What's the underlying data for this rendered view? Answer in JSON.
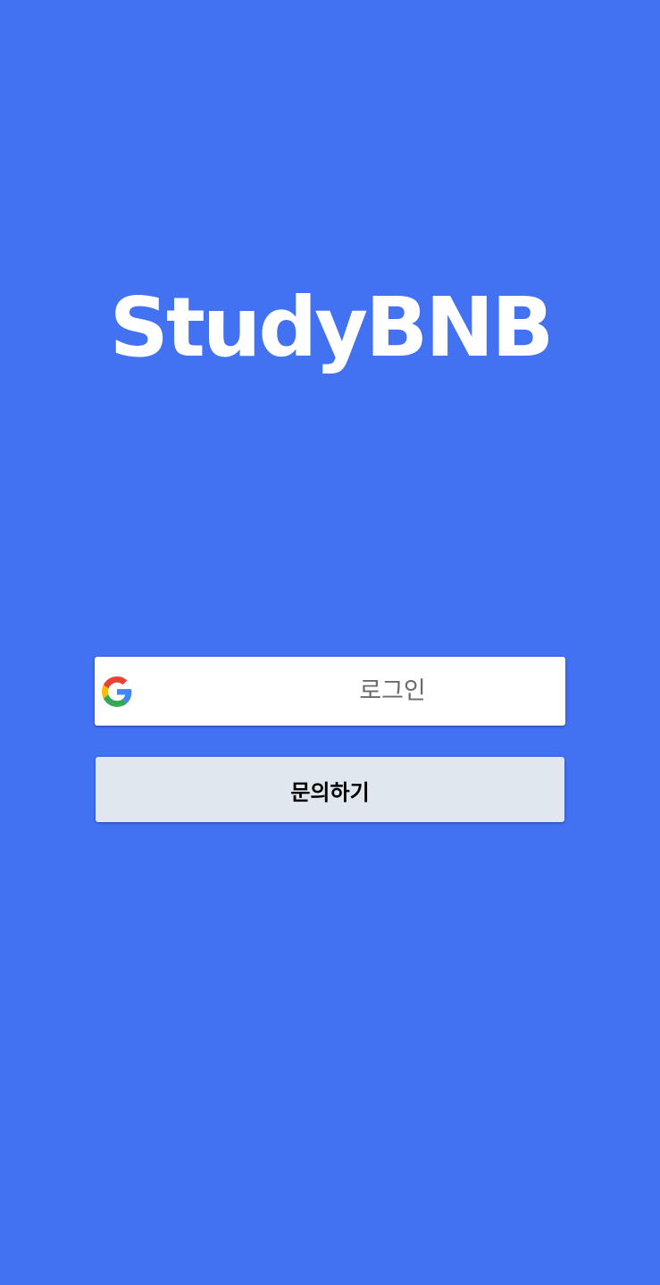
{
  "app": {
    "logo_text": "StudyBNB"
  },
  "buttons": {
    "google_login_label": "로그인",
    "inquiry_label": "문의하기"
  },
  "icons": {
    "google": "google-g-icon"
  },
  "colors": {
    "background": "#4271f2",
    "login_button": "#ffffff",
    "inquiry_button": "#e1e7ef",
    "google_blue": "#4285F4",
    "google_red": "#EA4335",
    "google_yellow": "#FBBC05",
    "google_green": "#34A853"
  }
}
